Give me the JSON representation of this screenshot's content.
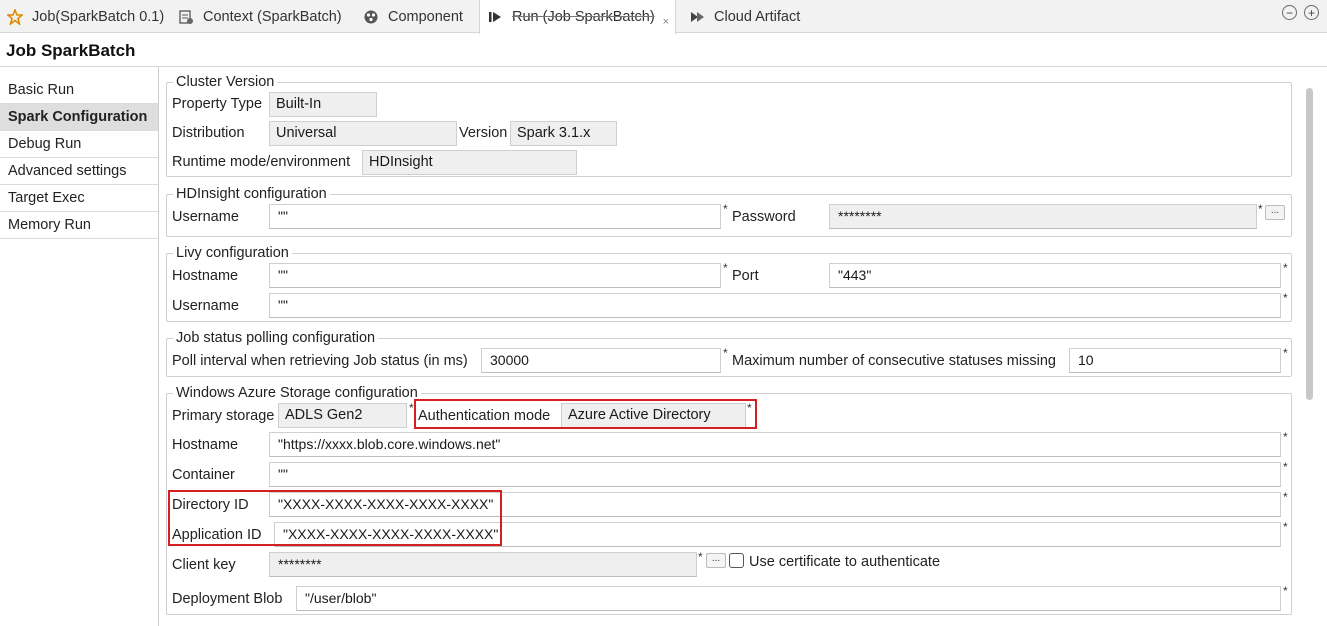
{
  "tabs": [
    {
      "label": "Job(SparkBatch 0.1)",
      "icon": "job-star-icon",
      "active": false
    },
    {
      "label": "Context (SparkBatch)",
      "icon": "context-icon",
      "active": false
    },
    {
      "label": "Component",
      "icon": "component-icon",
      "active": false
    },
    {
      "label": "Run (Job SparkBatch)",
      "icon": "run-icon",
      "active": true,
      "close": "×"
    },
    {
      "label": "Cloud Artifact",
      "icon": "cloud-artifact-icon",
      "active": false
    }
  ],
  "window_controls": {
    "minimize": "−",
    "maximize": "+"
  },
  "page_title": "Job SparkBatch",
  "sidebar": {
    "items": [
      {
        "label": "Basic Run",
        "selected": false
      },
      {
        "label": "Spark Configuration",
        "selected": true
      },
      {
        "label": "Debug Run",
        "selected": false
      },
      {
        "label": "Advanced settings",
        "selected": false
      },
      {
        "label": "Target Exec",
        "selected": false
      },
      {
        "label": "Memory Run",
        "selected": false
      }
    ]
  },
  "required_marker": "*",
  "ellipsis": "...",
  "cluster": {
    "legend": "Cluster Version",
    "property_type_label": "Property Type",
    "property_type_value": "Built-In",
    "distribution_label": "Distribution",
    "distribution_value": "Universal",
    "version_label": "Version",
    "version_value": "Spark 3.1.x",
    "runtime_label": "Runtime mode/environment",
    "runtime_value": "HDInsight"
  },
  "hdinsight": {
    "legend": "HDInsight configuration",
    "username_label": "Username",
    "username_value": "\"\"",
    "password_label": "Password",
    "password_value": "********"
  },
  "livy": {
    "legend": "Livy configuration",
    "hostname_label": "Hostname",
    "hostname_value": "\"\"",
    "port_label": "Port",
    "port_value": "\"443\"",
    "username_label": "Username",
    "username_value": "\"\""
  },
  "polling": {
    "legend": "Job status polling configuration",
    "interval_label": "Poll interval when retrieving Job status (in ms)",
    "interval_value": "30000",
    "max_missing_label": "Maximum number of consecutive statuses missing",
    "max_missing_value": "10"
  },
  "azure": {
    "legend": "Windows Azure Storage configuration",
    "primary_storage_label": "Primary storage",
    "primary_storage_value": "ADLS Gen2",
    "auth_mode_label": "Authentication mode",
    "auth_mode_value": "Azure Active Directory",
    "hostname_label": "Hostname",
    "hostname_value": "\"https://xxxx.blob.core.windows.net\"",
    "container_label": "Container",
    "container_value": "\"\"",
    "directory_id_label": "Directory ID",
    "directory_id_value": "\"XXXX-XXXX-XXXX-XXXX-XXXX\"",
    "application_id_label": "Application ID",
    "application_id_value": "\"XXXX-XXXX-XXXX-XXXX-XXXX\"",
    "client_key_label": "Client key",
    "client_key_value": "********",
    "use_cert_label": "Use certificate to authenticate",
    "use_cert_checked": false,
    "deployment_blob_label": "Deployment Blob",
    "deployment_blob_value": "\"/user/blob\""
  },
  "highlight_color": "#d42020"
}
